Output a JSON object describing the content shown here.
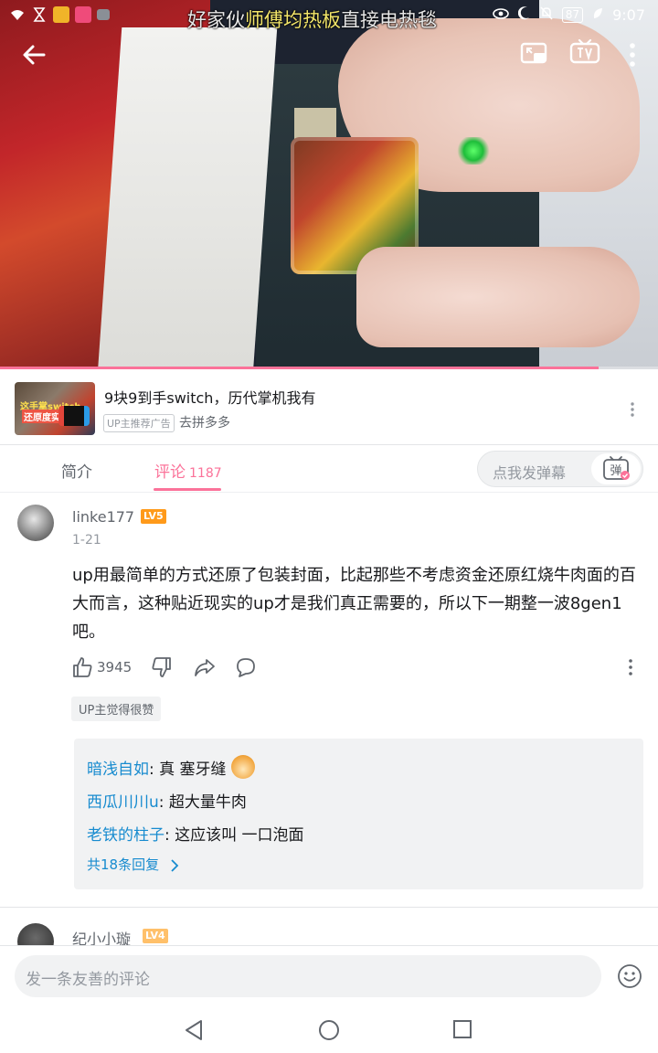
{
  "status_bar": {
    "time": "9:07",
    "battery": "87"
  },
  "danmaku": {
    "part1": "好家伙",
    "part2": "师傅均热板",
    "part3": "直接电热毯"
  },
  "video": {
    "progress_fraction": 0.91
  },
  "ad": {
    "thumb_text1": "这手掌switch",
    "thumb_text2": "还原度实的",
    "title": "9块9到手switch，历代掌机我有",
    "tag": "UP主推荐广告",
    "subtitle": "去拼多多"
  },
  "tabs": {
    "intro": "简介",
    "comments": "评论",
    "comments_count": "1187",
    "danmaku_placeholder": "点我发弹幕",
    "danmaku_btn": "弹"
  },
  "comment": {
    "username": "linke177",
    "level": "LV5",
    "date": "1-21",
    "text": "up用最简单的方式还原了包装封面，比起那些不考虑资金还原红烧牛肉面的百大而言，这种贴近现实的up才是我们真正需要的，所以下一期整一波8gen1吧。",
    "likes": "3945",
    "up_tag": "UP主觉得很赞",
    "replies": [
      {
        "user": "暗浅自如",
        "text": ": 真 塞牙缝"
      },
      {
        "user": "西瓜川川u",
        "text": ": 超大量牛肉"
      },
      {
        "user": "老铁的柱子",
        "text": ": 这应该叫 一口泡面"
      }
    ],
    "more_replies": "共18条回复"
  },
  "comment2": {
    "username": "纪小小璇",
    "level": "LV4"
  },
  "bottom": {
    "input_placeholder": "发一条友善的评论"
  },
  "colors": {
    "accent": "#fb7299",
    "link": "#178bcf",
    "lv5": "#ff9a1a",
    "lv4": "#ffc06a"
  }
}
